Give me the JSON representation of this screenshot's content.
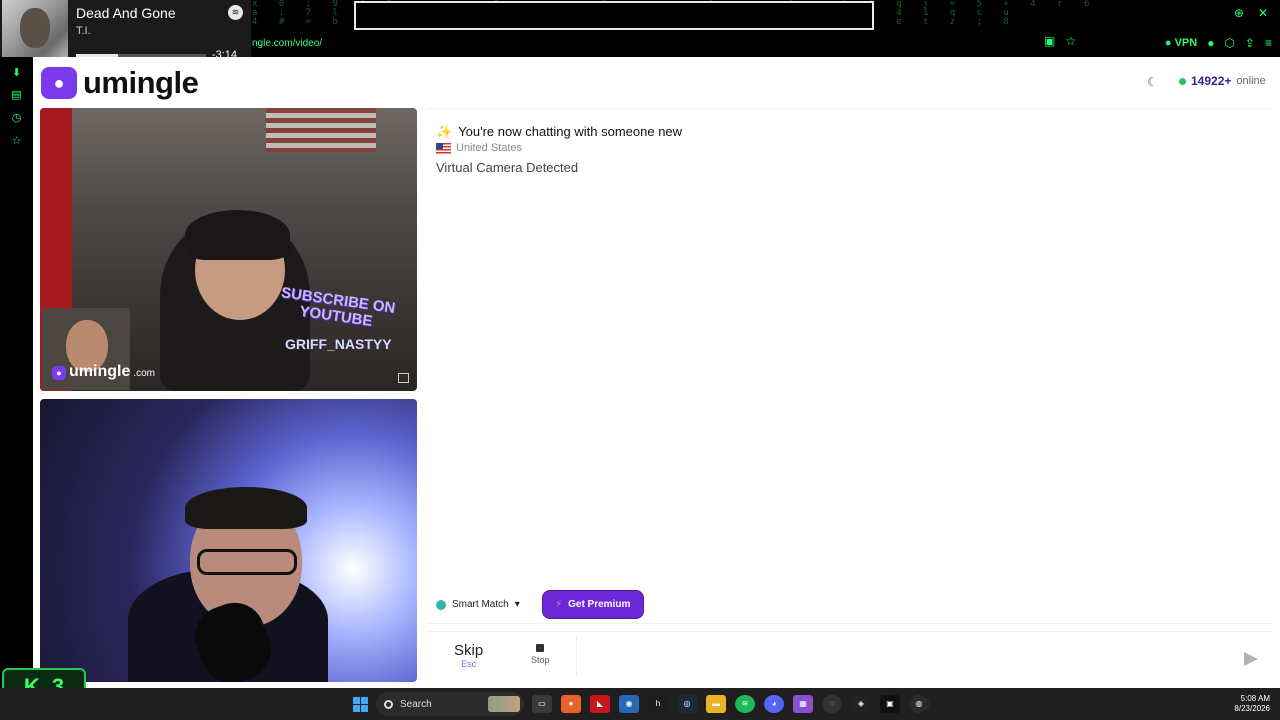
{
  "browser": {
    "url": "ngle.com/video/",
    "vpn_label": "VPN"
  },
  "spotify": {
    "title": "Dead And Gone",
    "artist": "T.I.",
    "time_left": "-3:14",
    "progress_fraction": 0.32
  },
  "site": {
    "name": "umingle",
    "online_count": "14922+",
    "online_label": "online"
  },
  "video_top": {
    "overlay_subscribe": "SUBSCRIBE ON YOUTUBE",
    "overlay_name": "GRIFF_NASTYY",
    "watermark_name": "umingle",
    "watermark_tld": ".com"
  },
  "chat": {
    "status": "You're now chatting with someone new",
    "country": "United States",
    "notice": "Virtual Camera Detected"
  },
  "controls": {
    "smart_match": "Smart Match",
    "premium": "Get Premium",
    "skip": "Skip",
    "skip_key": "Esc",
    "stop": "Stop"
  },
  "kick_badge": {
    "letter": "K",
    "number": "3"
  },
  "taskbar": {
    "search": "Search",
    "time": "5:08 AM",
    "date": "8/23/2026"
  },
  "colors": {
    "accent": "#7c3aed",
    "online_dot": "#22c55e",
    "terminal_green": "#23ff6a"
  }
}
